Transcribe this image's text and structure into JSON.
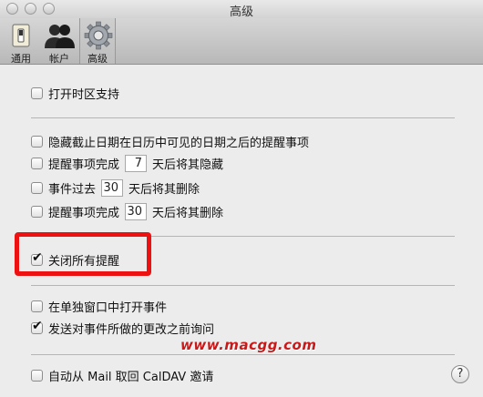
{
  "window": {
    "title": "高级"
  },
  "toolbar": {
    "tabs": [
      {
        "label": "通用",
        "icon": "switch-icon"
      },
      {
        "label": "帐户",
        "icon": "people-icon"
      },
      {
        "label": "高级",
        "icon": "gear-icon"
      }
    ],
    "active_tab": "高级"
  },
  "options": {
    "timezone": {
      "label": "打开时区支持",
      "checked": false
    },
    "hide_past_due": {
      "label": "隐藏截止日期在日历中可见的日期之后的提醒事项",
      "checked": false
    },
    "hide_completed_reminders": {
      "prefix": "提醒事项完成",
      "value": "7",
      "suffix": "天后将其隐藏",
      "checked": false
    },
    "delete_past_events": {
      "prefix": "事件过去",
      "value": "30",
      "suffix": "天后将其删除",
      "checked": false
    },
    "delete_completed_reminders": {
      "prefix": "提醒事项完成",
      "value": "30",
      "suffix": "天后将其删除",
      "checked": false
    },
    "turn_off_alerts": {
      "label": "关闭所有提醒",
      "checked": true
    },
    "open_in_separate_window": {
      "label": "在单独窗口中打开事件",
      "checked": false
    },
    "ask_before_sending_changes": {
      "label": "发送对事件所做的更改之前询问",
      "checked": true
    },
    "auto_retrieve_invites": {
      "label": "自动从 Mail 取回 CalDAV 邀请",
      "checked": false
    }
  },
  "watermark": "www.macgg.com",
  "help_label": "?"
}
